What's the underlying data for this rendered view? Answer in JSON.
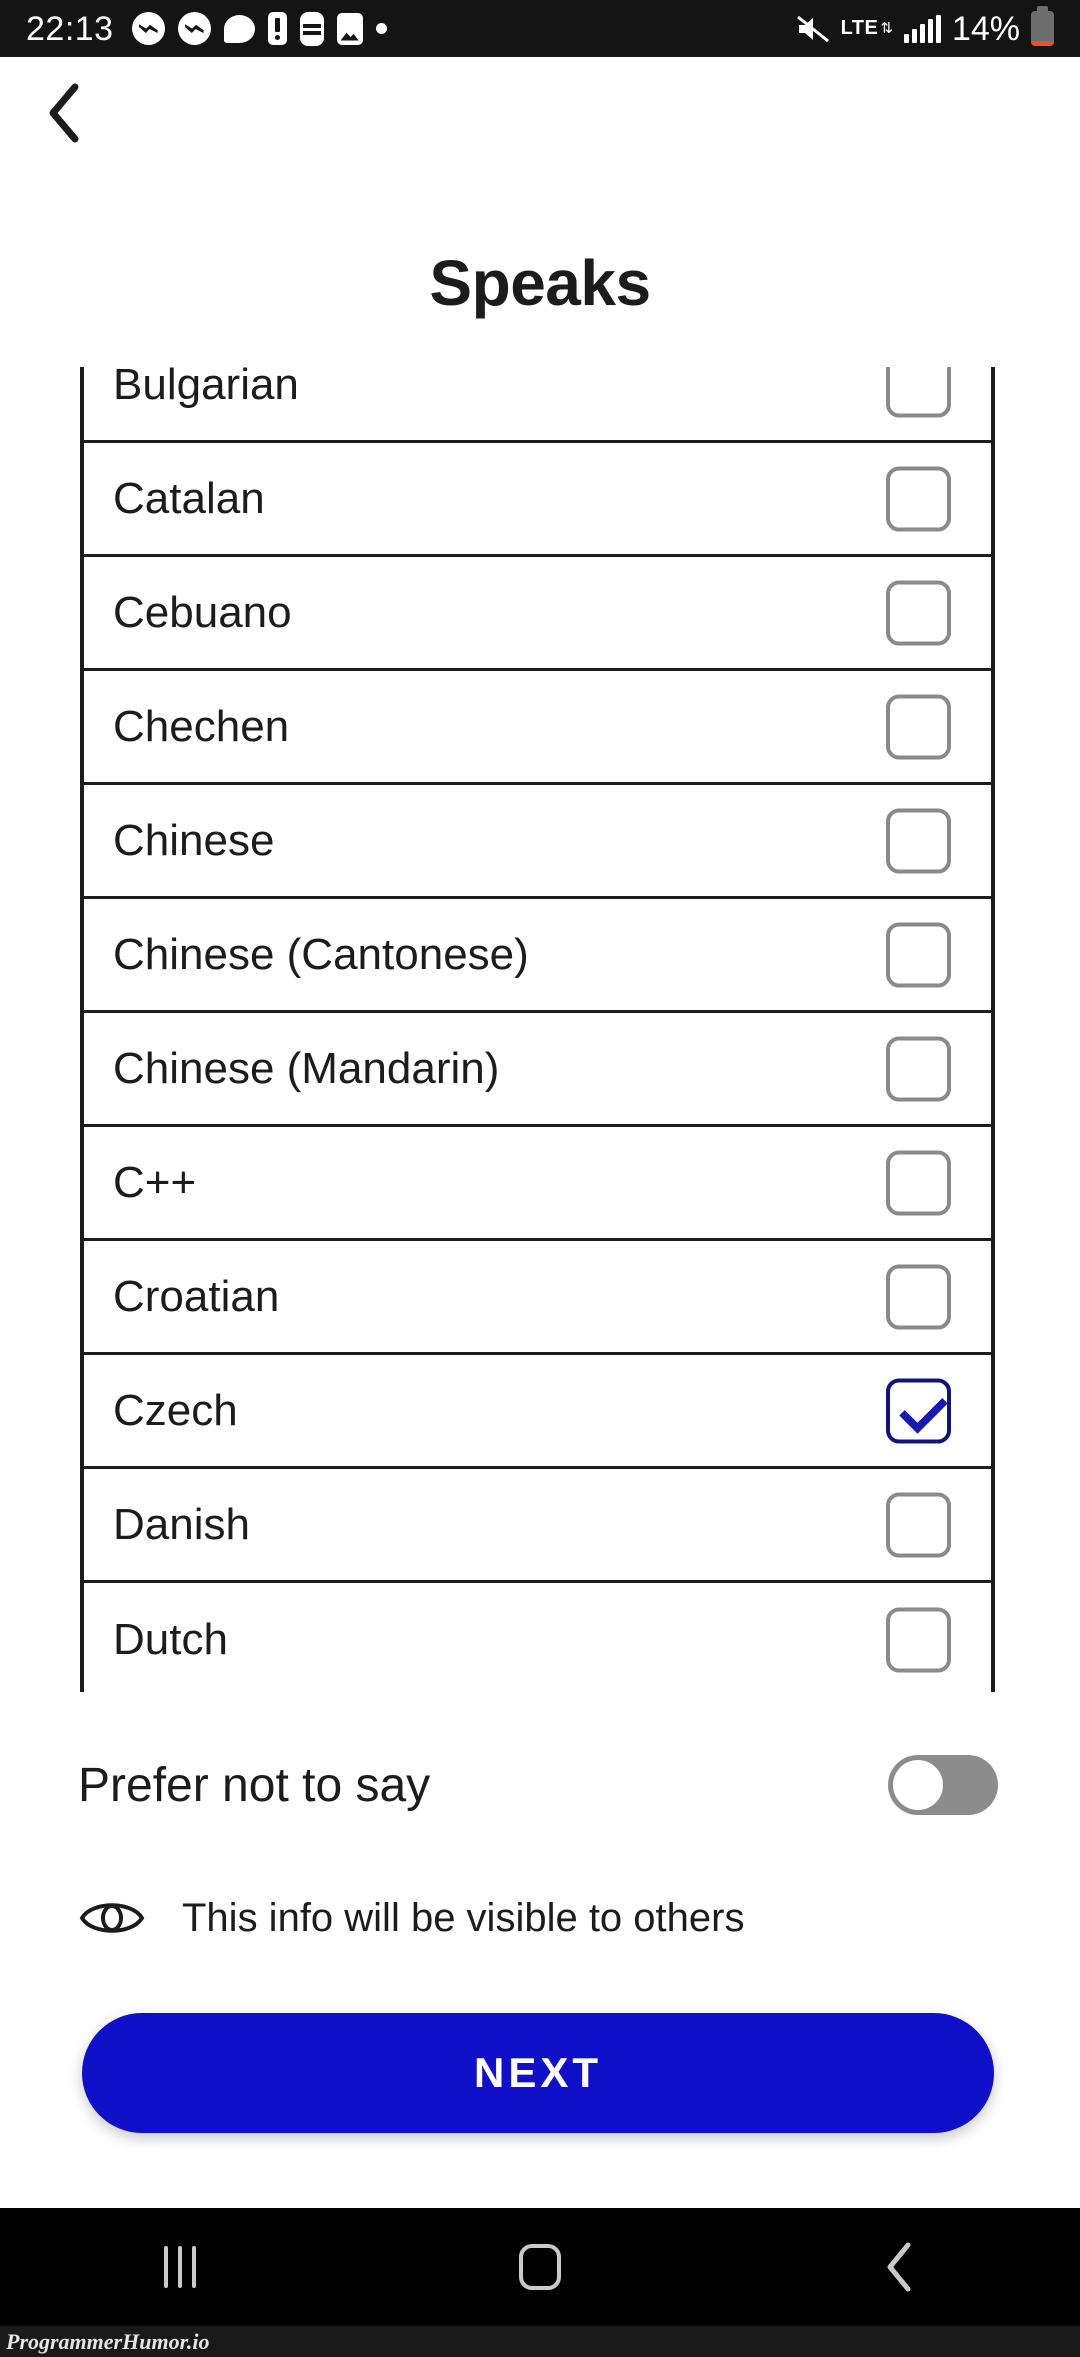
{
  "statusbar": {
    "time": "22:13",
    "battery_percent": "14%",
    "network_type": "LTE",
    "left_icons": [
      "messenger-icon",
      "messenger-icon",
      "chat-bubble-icon",
      "battery-alert-icon",
      "watch-icon",
      "photo-icon",
      "dot-icon"
    ],
    "right_icons": [
      "mute-icon",
      "lte-icon",
      "signal-bars-icon",
      "battery-icon"
    ],
    "battery_level_fraction": 14,
    "bg_color": "#141414"
  },
  "header": {
    "back_label": "Back",
    "title": "Speaks"
  },
  "list": {
    "rows": [
      {
        "label": "Bulgarian",
        "checked": false
      },
      {
        "label": "Catalan",
        "checked": false
      },
      {
        "label": "Cebuano",
        "checked": false
      },
      {
        "label": "Chechen",
        "checked": false
      },
      {
        "label": "Chinese",
        "checked": false
      },
      {
        "label": "Chinese (Cantonese)",
        "checked": false
      },
      {
        "label": "Chinese (Mandarin)",
        "checked": false
      },
      {
        "label": "C++",
        "checked": false
      },
      {
        "label": "Croatian",
        "checked": false
      },
      {
        "label": "Czech",
        "checked": true
      },
      {
        "label": "Danish",
        "checked": false
      },
      {
        "label": "Dutch",
        "checked": false
      }
    ]
  },
  "prefer": {
    "label": "Prefer not to say",
    "toggle_on": false
  },
  "visibility": {
    "icon": "eye-icon",
    "text": "This info will be visible to others"
  },
  "next": {
    "label": "NEXT",
    "color": "#1010c8"
  },
  "navbar": {
    "recents_label": "Recents",
    "home_label": "Home",
    "back_label": "Back"
  },
  "watermark": {
    "text": "ProgrammerHumor.io"
  }
}
